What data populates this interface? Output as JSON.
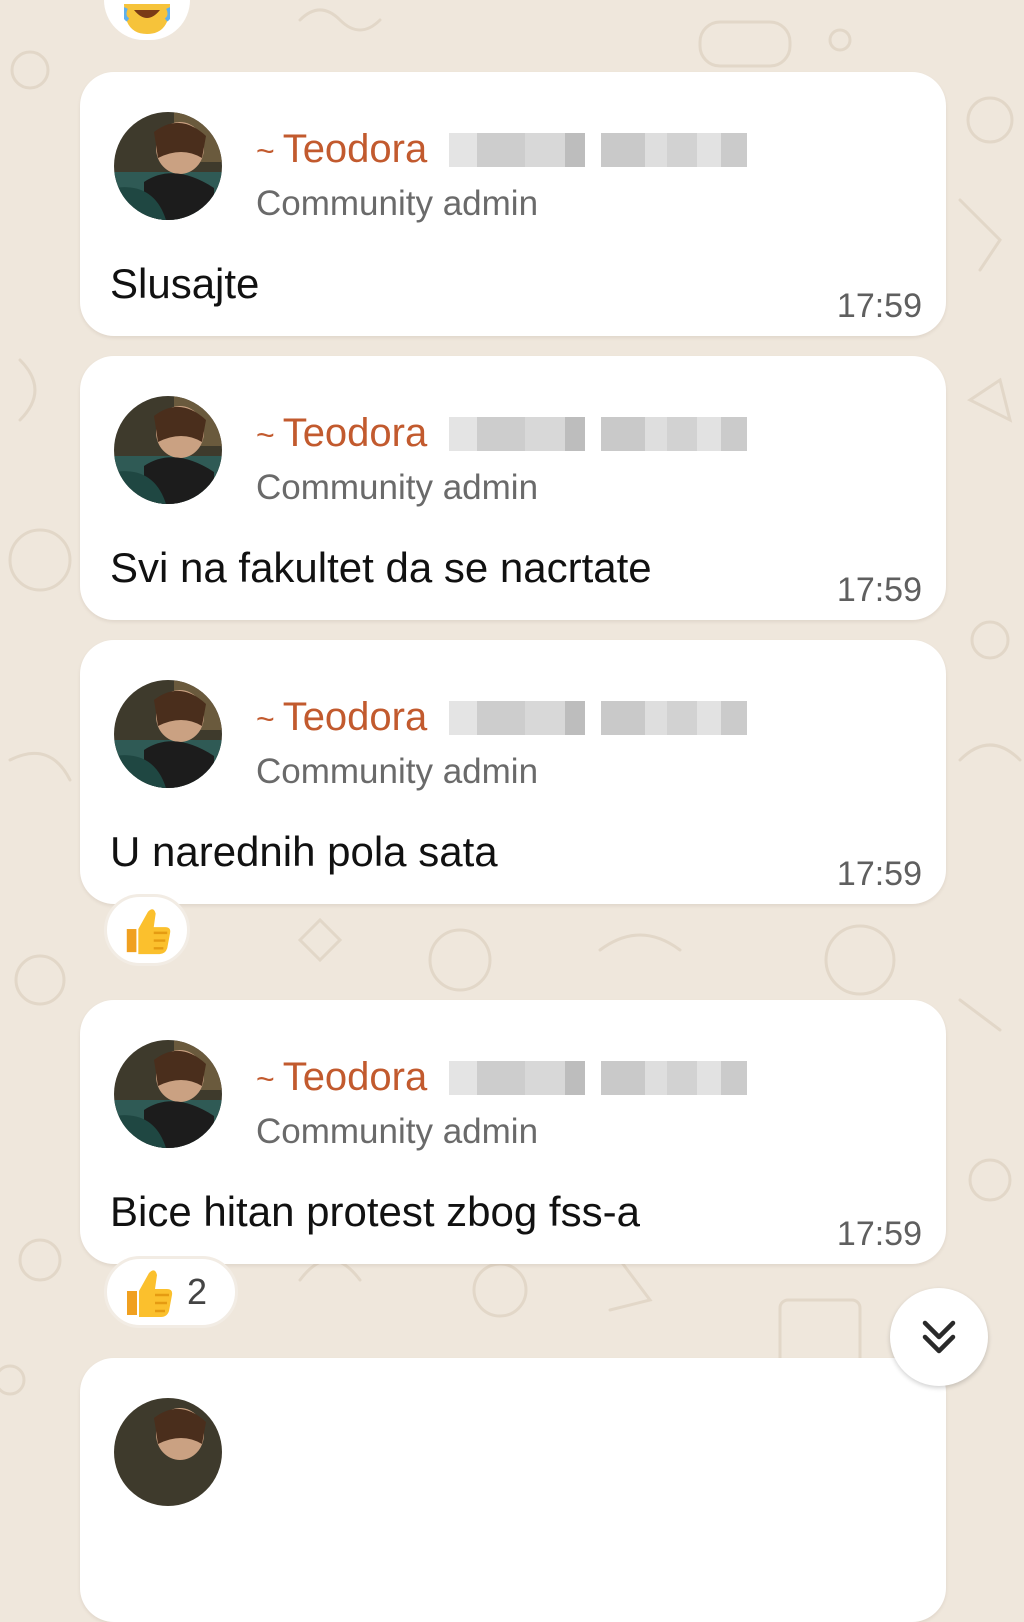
{
  "theme": {
    "background": "#efe7dc",
    "bubble": "#ffffff",
    "sender_color": "#c25a2e",
    "role_color": "#6a6a6a",
    "time_color": "#5f5f5f"
  },
  "top_reaction": {
    "emoji": "laughing-face-icon"
  },
  "messages": [
    {
      "sender": "~ Teodora",
      "sender_tilde": "~",
      "sender_name": "Teodora",
      "role": "Community admin",
      "text": "Slusajte",
      "time": "17:59"
    },
    {
      "sender": "~ Teodora",
      "sender_tilde": "~",
      "sender_name": "Teodora",
      "role": "Community admin",
      "text": "Svi na fakultet da se nacrtate",
      "time": "17:59"
    },
    {
      "sender": "~ Teodora",
      "sender_tilde": "~",
      "sender_name": "Teodora",
      "role": "Community admin",
      "text": "U narednih pola sata",
      "time": "17:59",
      "reaction": {
        "emoji": "thumbs-up-icon"
      }
    },
    {
      "sender": "~ Teodora",
      "sender_tilde": "~",
      "sender_name": "Teodora",
      "role": "Community admin",
      "text": "Bice hitan protest zbog fss-a",
      "time": "17:59",
      "reaction": {
        "emoji": "thumbs-up-icon",
        "count": "2"
      }
    }
  ],
  "scroll_button": {
    "icon": "double-chevron-down-icon"
  }
}
